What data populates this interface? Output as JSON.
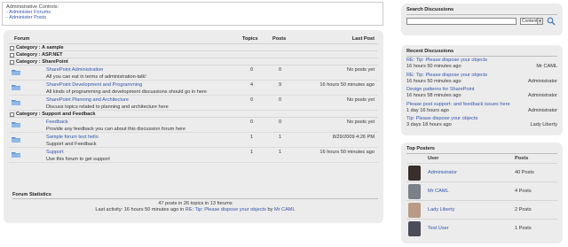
{
  "admin": {
    "title": "Administrative Controls:",
    "links": [
      "- Administer Forums",
      "- Administer Posts"
    ]
  },
  "forum": {
    "columns": {
      "forum": "Forum",
      "topics": "Topics",
      "posts": "Posts",
      "last_post": "Last Post"
    },
    "categories": [
      {
        "label": "Category : A sample",
        "forums": []
      },
      {
        "label": "Category : ASP.NET",
        "forums": []
      },
      {
        "label": "Category : SharePoint",
        "forums": [
          {
            "name": "SharePoint Administration",
            "desc": "All you can eat in terms of administration-talk!",
            "topics": "0",
            "posts": "0",
            "last": "No posts yet"
          },
          {
            "name": "SharePoint Development and Programming",
            "desc": "All kinds of programming and development discussions should go in here",
            "topics": "4",
            "posts": "9",
            "last": "16 hours 50 minutes ago"
          },
          {
            "name": "SharePoint Planning and Architecture",
            "desc": "Discuss topics related to planning and architecture here",
            "topics": "0",
            "posts": "0",
            "last": "No posts yet"
          }
        ]
      },
      {
        "label": "Category : Support and Feedback",
        "forums": [
          {
            "name": "Feedback",
            "desc": "Provide any feedback you can about this discussion forum here",
            "topics": "0",
            "posts": "0",
            "last": "No posts yet"
          },
          {
            "name": "Sample forum test hello",
            "desc": "Support and Feedback",
            "topics": "1",
            "posts": "1",
            "last": "8/29/2009 4:26 PM"
          },
          {
            "name": "Support",
            "desc": "Use this forum to get support",
            "topics": "1",
            "posts": "1",
            "last": "16 hours 50 minutes ago"
          }
        ]
      }
    ],
    "stats": {
      "title": "Forum Statistics",
      "line1": "47 posts in 26 topics in 13 forums",
      "line2_prefix": "Last activity: 16 hours 50 minutes ago in",
      "line2_link": "RE: Tip: Please dispose your objects",
      "line2_by": "by",
      "line2_user": "Mr CAML"
    }
  },
  "search": {
    "title": "Search Discussions",
    "input_value": "",
    "scope_selected": "Content"
  },
  "recent": {
    "title": "Recent Discussions",
    "items": [
      {
        "title": "RE: Tip: Please dispose your objects",
        "time": "16 hours 50 minutes ago",
        "user": "Mr CAML"
      },
      {
        "title": "RE: Tip: Please dispose your objects",
        "time": "16 hours 50 minutes ago",
        "user": "Administrator"
      },
      {
        "title": "Design patterns for SharePoint",
        "time": "16 hours 58 minutes ago",
        "user": "Administrator"
      },
      {
        "title": "Please post support- and feedback issues here",
        "time": "1 day 16 hours ago",
        "user": "Administrator"
      },
      {
        "title": "Tip: Please dispose your objects",
        "time": "3 days 18 hours ago",
        "user": "Lady Liberty"
      }
    ]
  },
  "top_posters": {
    "title": "Top Posters",
    "col_user": "User",
    "col_posts": "Posts",
    "rows": [
      {
        "user": "Administrator",
        "posts": "40 Posts",
        "avatar_color": "#3a2e2a"
      },
      {
        "user": "Mr CAML",
        "posts": "4 Posts",
        "avatar_color": "#7a7f88"
      },
      {
        "user": "Lady Liberty",
        "posts": "2 Posts",
        "avatar_color": "#b89a86"
      },
      {
        "user": "Test User",
        "posts": "1 Posts",
        "avatar_color": "#4b4b5a"
      }
    ]
  },
  "colors": {
    "link": "#3355aa",
    "panel": "#ececec",
    "folder_icon": "#5a8fd0"
  }
}
